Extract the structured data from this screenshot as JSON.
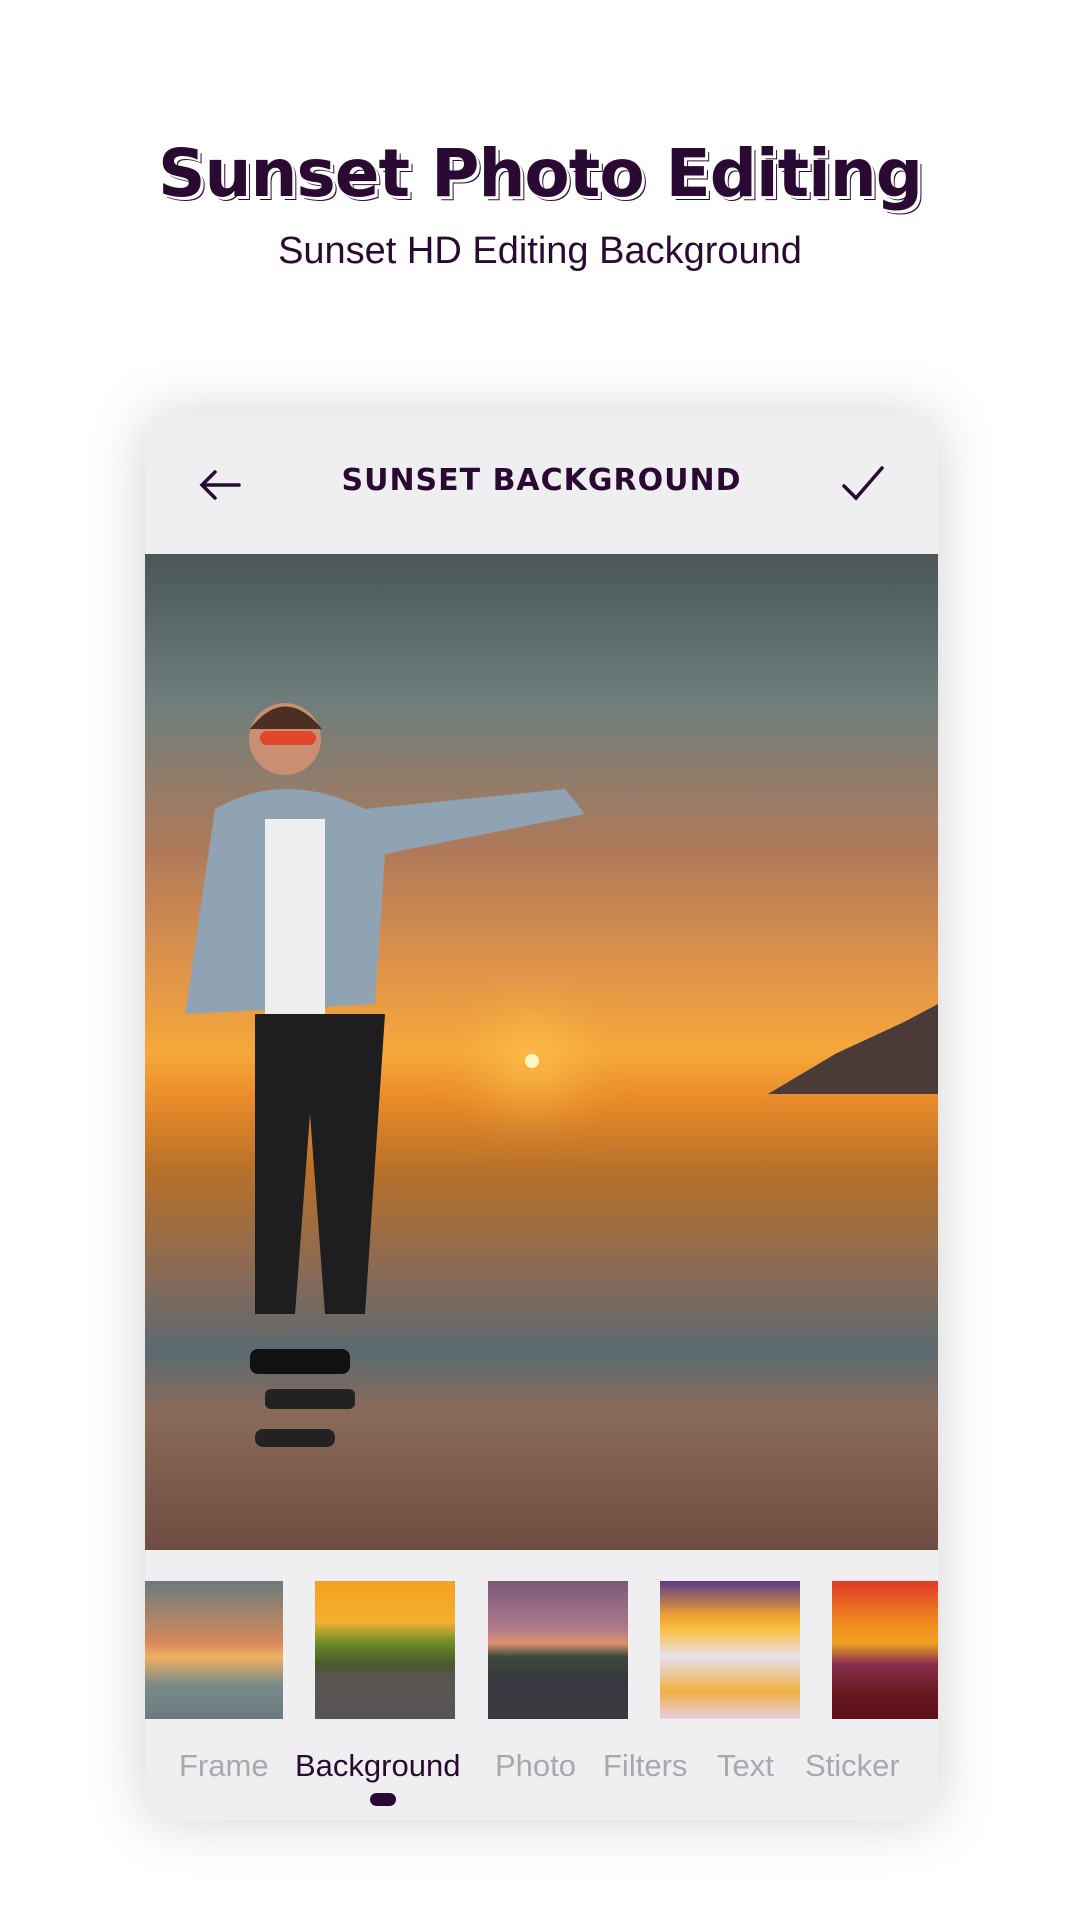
{
  "promo": {
    "title": "Sunset Photo Editing",
    "subtitle": "Sunset HD Editing Background"
  },
  "header": {
    "title": "SUNSET BACKGROUND",
    "back_icon": "arrow-left-icon",
    "confirm_icon": "check-icon"
  },
  "thumbnails": [
    {
      "name": "sea-sunset-clouds"
    },
    {
      "name": "orange-road-sunset"
    },
    {
      "name": "purple-road-sunset"
    },
    {
      "name": "snow-sunburst"
    },
    {
      "name": "desert-butte-sunset"
    }
  ],
  "tabs": [
    {
      "label": "Frame"
    },
    {
      "label": "Background"
    },
    {
      "label": "Photo"
    },
    {
      "label": "Filters"
    },
    {
      "label": "Text"
    },
    {
      "label": "Sticker"
    }
  ],
  "active_tab": "Background",
  "colors": {
    "accent": "#2a0a33",
    "inactive": "#aaa8ad",
    "card": "#efeef0"
  }
}
